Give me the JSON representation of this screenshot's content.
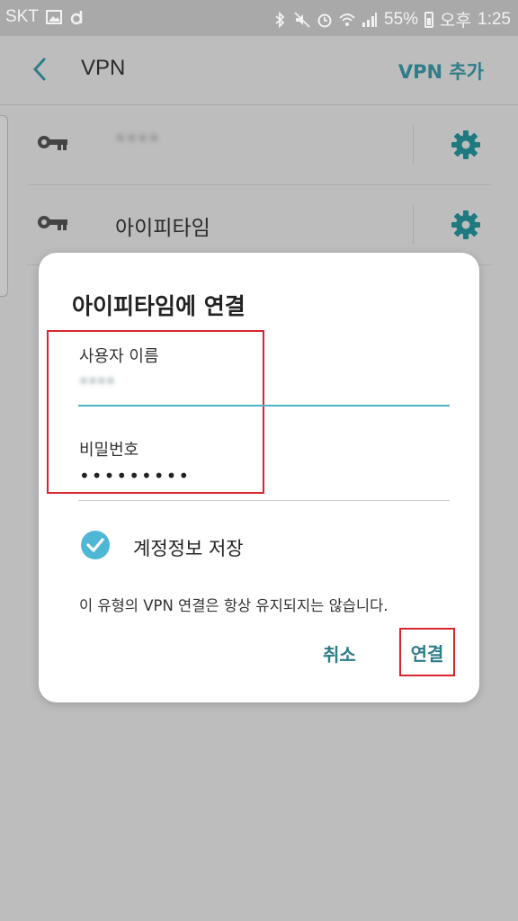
{
  "status_bar": {
    "carrier": "SKT",
    "battery": "55%",
    "ampm": "오후",
    "time": "1:25"
  },
  "app_bar": {
    "title": "VPN",
    "add_button": "VPN 추가"
  },
  "vpn_list": [
    {
      "label": "****"
    },
    {
      "label": "아이피타임"
    }
  ],
  "dialog": {
    "title": "아이피타임에 연결",
    "username_label": "사용자 이름",
    "username_value": "****",
    "password_label": "비밀번호",
    "password_value": "•••••••••",
    "save_checkbox_label": "계정정보 저장",
    "save_checked": true,
    "notice": "이 유형의 VPN 연결은 항상 유지되지는 않습니다.",
    "cancel_label": "취소",
    "connect_label": "연결"
  },
  "colors": {
    "accent": "#2f7d88",
    "check": "#4fb7d6",
    "highlight": "#d9262c",
    "gear": "#1f7a80"
  }
}
